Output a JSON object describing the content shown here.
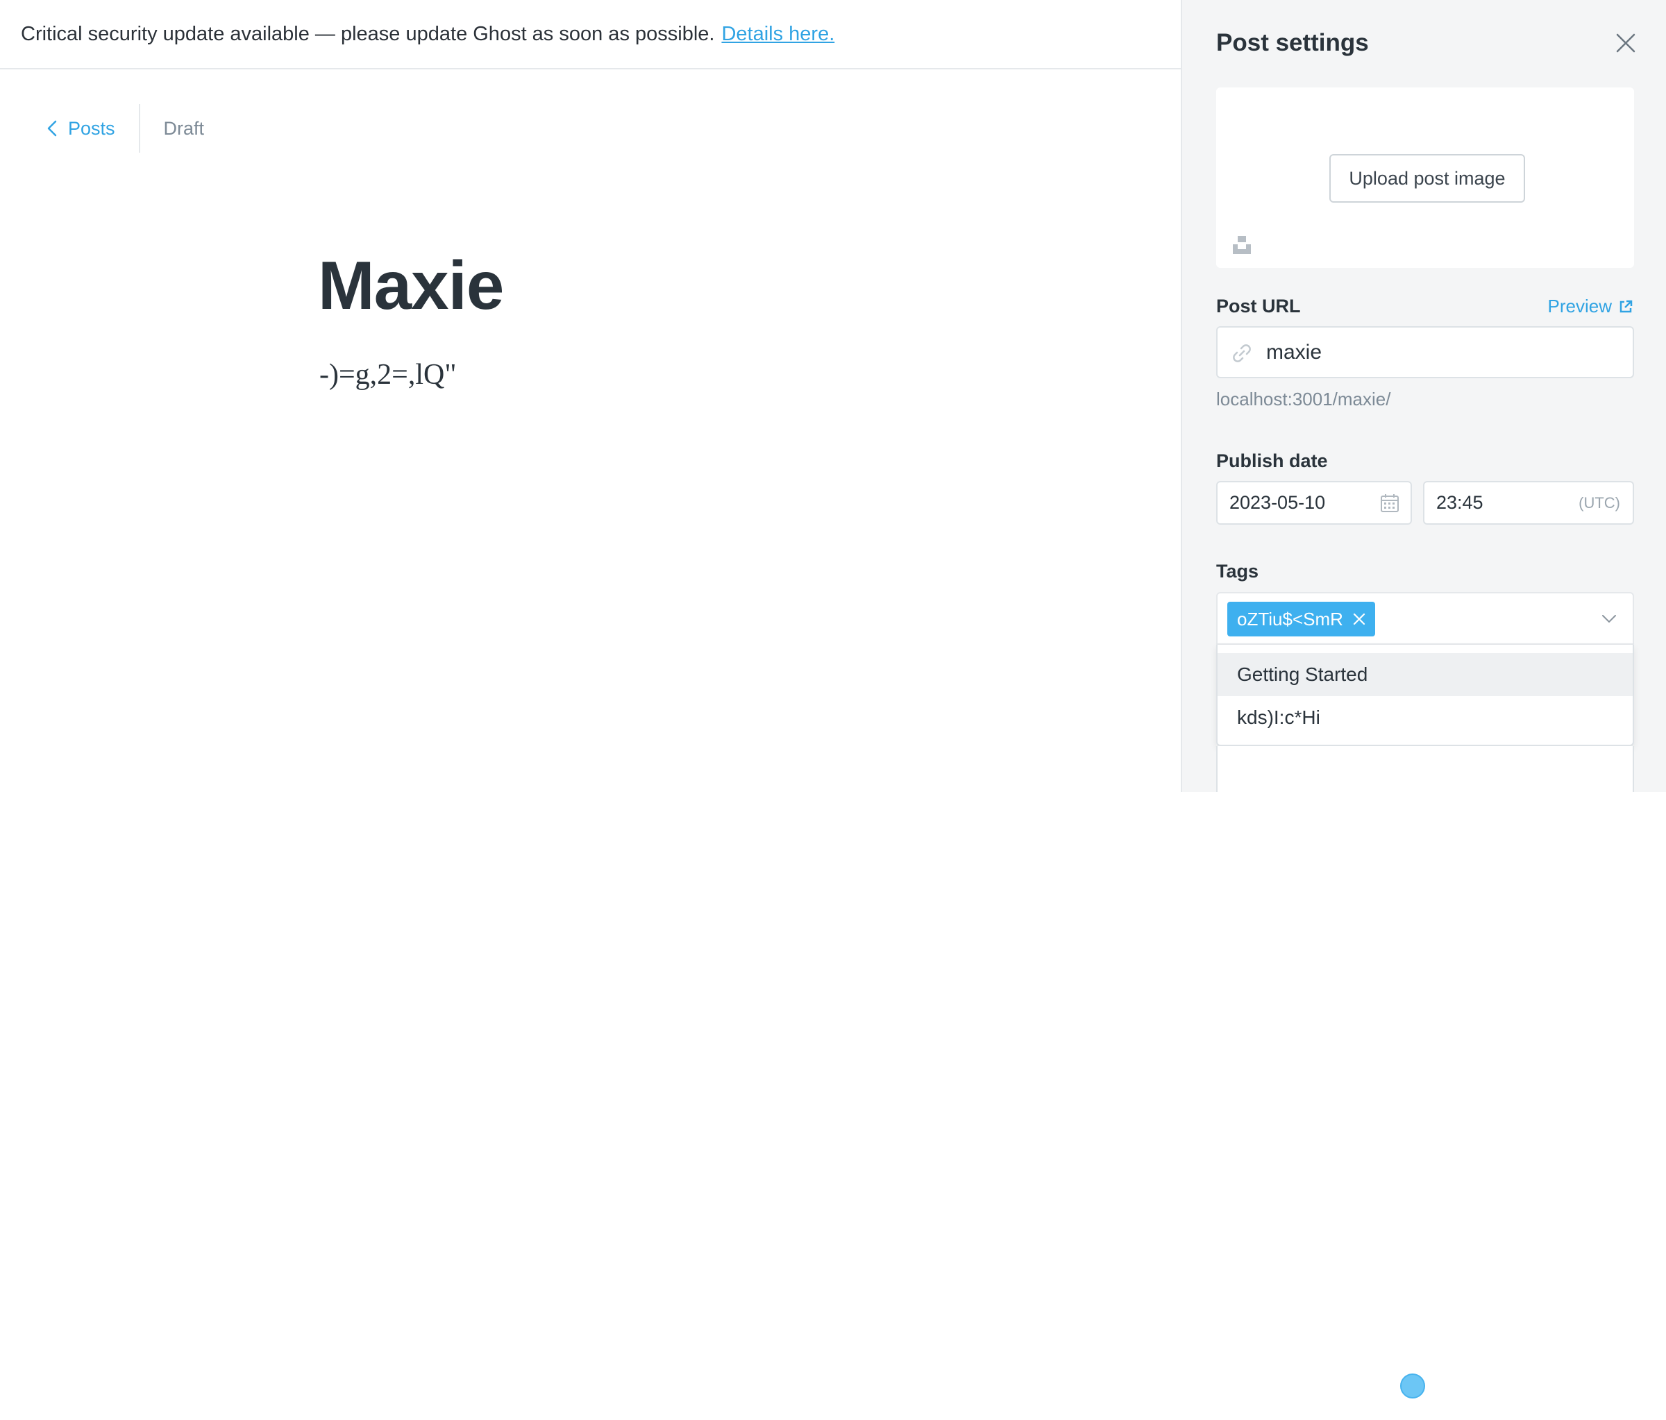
{
  "banner": {
    "message": "Critical security update available — please update Ghost as soon as possible.",
    "link_label": "Details here."
  },
  "breadcrumb": {
    "back_label": "Posts",
    "status": "Draft"
  },
  "post": {
    "title": "Maxie",
    "body": "-)=g,2=,lQ\""
  },
  "settings": {
    "title": "Post settings",
    "upload_label": "Upload post image",
    "url": {
      "label": "Post URL",
      "preview_label": "Preview",
      "value": "maxie",
      "hint": "localhost:3001/maxie/"
    },
    "publish": {
      "label": "Publish date",
      "date": "2023-05-10",
      "time": "23:45",
      "timezone": "(UTC)"
    },
    "tags": {
      "label": "Tags",
      "selected": [
        "oZTiu$<SmR"
      ],
      "options": [
        "Getting Started",
        "kds)I:c*Hi"
      ]
    }
  },
  "colors": {
    "accent": "#30a3e3",
    "tag_bg": "#3eb0ef",
    "panel_bg": "#f4f5f6"
  }
}
